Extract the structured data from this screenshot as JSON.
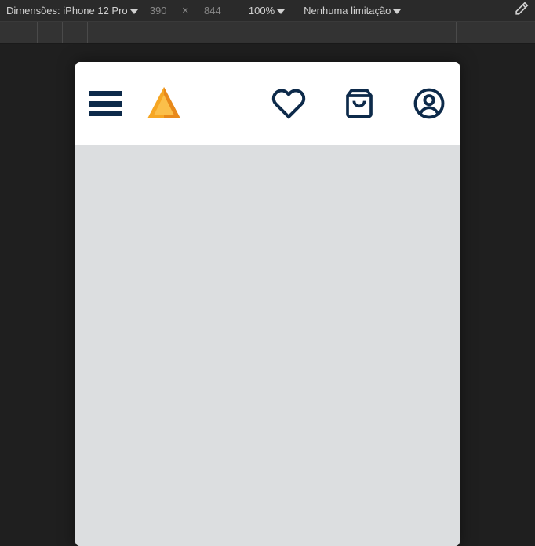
{
  "devtools": {
    "dimensions_label": "Dimensões:",
    "device": "iPhone 12 Pro",
    "width": "390",
    "height": "844",
    "zoom": "100%",
    "throttling": "Nenhuma limitação"
  },
  "app": {
    "icons": {
      "menu": "menu",
      "logo": "logo",
      "heart": "favorites",
      "bag": "shopping-bag",
      "account": "account"
    },
    "colors": {
      "primary": "#0d2a4a",
      "logo_orange": "#f59e0b",
      "logo_dark": "#d97706",
      "content_bg": "#dcdee0"
    }
  }
}
